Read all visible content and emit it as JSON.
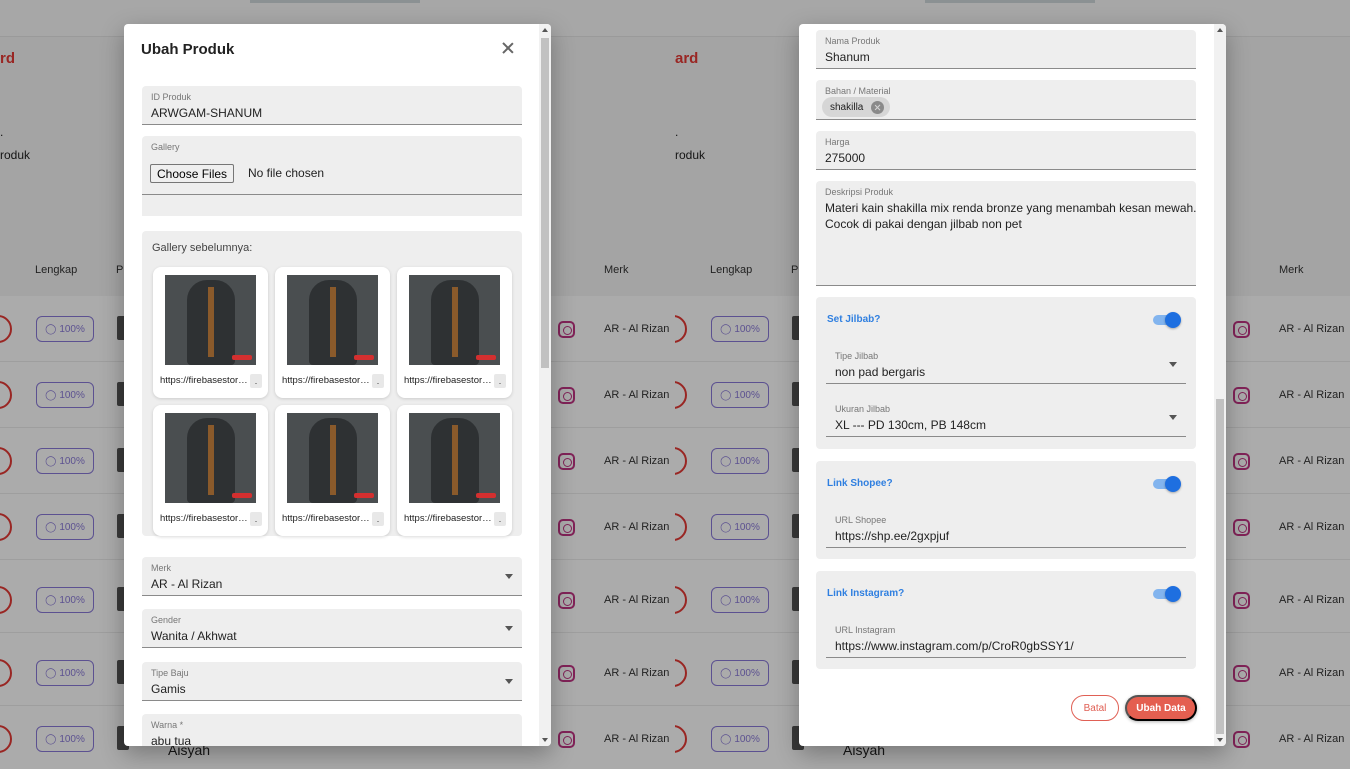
{
  "background": {
    "brand_fragment_left": "rd",
    "brand_fragment_right": "ard",
    "menu_word": "roduk",
    "col_lengkap": "Lengkap",
    "col_p": "P",
    "col_merk": "Merk",
    "row_pill": "100%",
    "row_circle": "i",
    "row_merk": "AR - Al Rizan",
    "footer_name": "Aisyah"
  },
  "dialog1": {
    "title": "Ubah Produk",
    "id_produk": {
      "label": "ID Produk",
      "value": "ARWGAM-SHANUM"
    },
    "gallery": {
      "label": "Gallery",
      "button": "Choose Files",
      "status": "No file chosen"
    },
    "gallery_prev": {
      "title": "Gallery sebelumnya:",
      "items": [
        {
          "url": "https://firebasestorage.googleapis.com/",
          "more": "."
        },
        {
          "url": "https://firebasestorage.googleapis.com/",
          "more": "."
        },
        {
          "url": "https://firebasestorage.googleapis.com/",
          "more": "."
        },
        {
          "url": "https://firebasestorage.googleapis.com/",
          "more": "."
        },
        {
          "url": "https://firebasestorage.googleapis.com/",
          "more": "."
        },
        {
          "url": "https://firebasestorage.googleapis.com/",
          "more": "."
        }
      ]
    },
    "merk": {
      "label": "Merk",
      "value": "AR - Al Rizan"
    },
    "gender": {
      "label": "Gender",
      "value": "Wanita / Akhwat"
    },
    "tipe_baju": {
      "label": "Tipe Baju",
      "value": "Gamis"
    },
    "warna": {
      "label": "Warna *",
      "value": "abu tua"
    }
  },
  "dialog2": {
    "nama_produk": {
      "label": "Nama Produk",
      "value": "Shanum"
    },
    "bahan": {
      "label": "Bahan / Material",
      "chip": "shakilla"
    },
    "harga": {
      "label": "Harga",
      "value": "275000"
    },
    "deskripsi": {
      "label": "Deskripsi Produk",
      "line1": "Materi kain shakilla mix renda bronze yang menambah kesan mewah.",
      "line2": "Cocok di pakai dengan jilbab non pet"
    },
    "set_jilbab": {
      "label": "Set Jilbab?",
      "on": true
    },
    "tipe_jilbab": {
      "label": "Tipe Jilbab",
      "value": "non pad bergaris"
    },
    "ukuran_jilbab": {
      "label": "Ukuran Jilbab",
      "value": "XL --- PD 130cm, PB 148cm"
    },
    "link_shopee": {
      "label": "Link Shopee?",
      "on": true
    },
    "url_shopee": {
      "label": "URL Shopee",
      "value": "https://shp.ee/2gxpjuf"
    },
    "link_instagram": {
      "label": "Link Instagram?",
      "on": true
    },
    "url_instagram": {
      "label": "URL Instagram",
      "value": "https://www.instagram.com/p/CroR0gbSSY1/"
    },
    "btn_batal": "Batal",
    "btn_ubah": "Ubah Data"
  },
  "colors": {
    "accent_blue": "#1e6fe0",
    "danger_red": "#e45f50",
    "pill_purple": "#8a7ad8"
  }
}
